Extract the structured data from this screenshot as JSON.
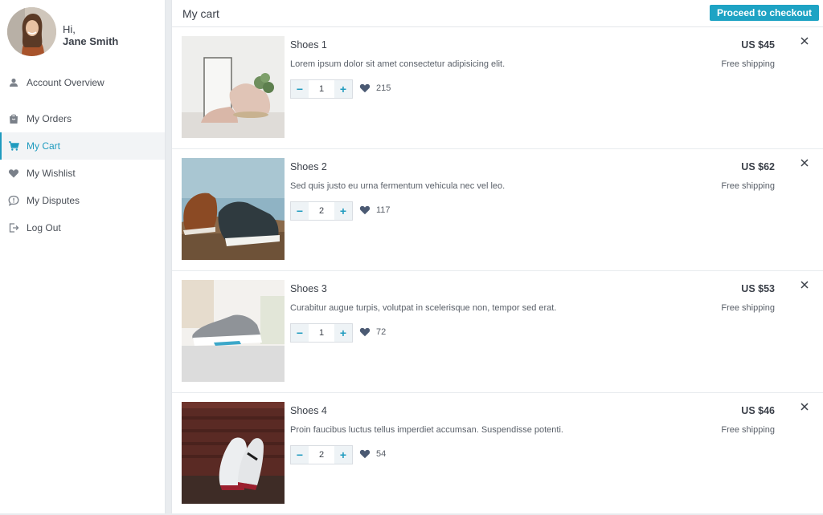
{
  "user": {
    "greeting": "Hi,",
    "name": "Jane Smith"
  },
  "nav": [
    {
      "label": "Account Overview",
      "icon": "person-icon"
    },
    {
      "label": "My Orders",
      "icon": "bag-icon"
    },
    {
      "label": "My Cart",
      "icon": "cart-icon",
      "active": true
    },
    {
      "label": "My Wishlist",
      "icon": "heart-icon"
    },
    {
      "label": "My Disputes",
      "icon": "chat-icon"
    },
    {
      "label": "Log Out",
      "icon": "logout-icon"
    }
  ],
  "header": {
    "title": "My cart",
    "checkout_label": "Proceed to checkout"
  },
  "cart": [
    {
      "name": "Shoes 1",
      "description": "Lorem ipsum dolor sit amet consectetur adipisicing elit.",
      "price": "US $45",
      "shipping": "Free shipping",
      "quantity": "1",
      "likes": "215",
      "minus": "−",
      "plus": "+"
    },
    {
      "name": "Shoes 2",
      "description": "Sed quis justo eu urna fermentum vehicula nec vel leo.",
      "price": "US $62",
      "shipping": "Free shipping",
      "quantity": "2",
      "likes": "117",
      "minus": "−",
      "plus": "+"
    },
    {
      "name": "Shoes 3",
      "description": "Curabitur augue turpis, volutpat in scelerisque non, tempor sed erat.",
      "price": "US $53",
      "shipping": "Free shipping",
      "quantity": "1",
      "likes": "72",
      "minus": "−",
      "plus": "+"
    },
    {
      "name": "Shoes 4",
      "description": "Proin faucibus luctus tellus imperdiet accumsan. Suspendisse potenti.",
      "price": "US $46",
      "shipping": "Free shipping",
      "quantity": "2",
      "likes": "54",
      "minus": "−",
      "plus": "+"
    }
  ],
  "colors": {
    "accent": "#1ea3c4",
    "heart": "#4b5a73",
    "text": "#3b4049"
  }
}
